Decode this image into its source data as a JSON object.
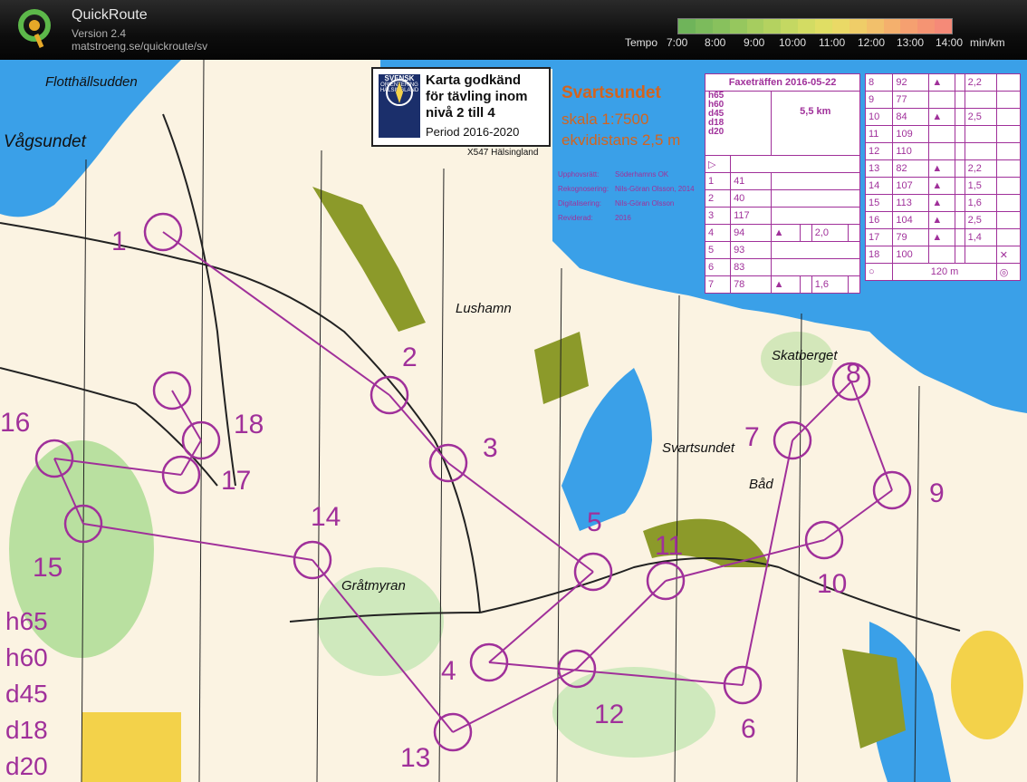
{
  "app": {
    "name": "QuickRoute",
    "version": "Version 2.4",
    "url": "matstroeng.se/quickroute/sv"
  },
  "tempo": {
    "label": "Tempo",
    "ticks": [
      "7:00",
      "8:00",
      "9:00",
      "10:00",
      "11:00",
      "12:00",
      "13:00",
      "14:00"
    ],
    "unit": "min/km"
  },
  "map": {
    "approval": {
      "line1": "Karta godkänd",
      "line2": "för tävling inom",
      "line3": "nivå 2 till 4",
      "period": "Period 2016-2020",
      "badge1": "SVENSK",
      "badge2": "ORIENTERING",
      "badge3": "HÄLSINGLAND",
      "code": "X547 Hälsingland"
    },
    "title": {
      "name": "Svartsundet",
      "scale": "skala 1:7500",
      "equidistance": "ekvidistans 2,5 m"
    },
    "credits": [
      {
        "label": "Upphovsrätt:",
        "value": "Söderhamns OK"
      },
      {
        "label": "Rekognosering:",
        "value": "Nils-Göran Olsson, 2014"
      },
      {
        "label": "Digitalisering:",
        "value": "Nils-Göran Olsson"
      },
      {
        "label": "Reviderad:",
        "value": "2016"
      }
    ],
    "places": [
      "Flotthällsudden",
      "Vågsundet",
      "Lushamn",
      "Skatberget",
      "Svartsundet",
      "Båd",
      "Gråtmyran"
    ],
    "controls": [
      "1",
      "2",
      "3",
      "4",
      "5",
      "6",
      "7",
      "8",
      "9",
      "10",
      "11",
      "12",
      "13",
      "14",
      "15",
      "16",
      "17",
      "18"
    ],
    "classes": [
      "h65",
      "h60",
      "d45",
      "d18",
      "d20"
    ],
    "descriptions": {
      "event": "Faxeträffen 2016-05-22",
      "classes": [
        "h65",
        "h60",
        "d45",
        "d18",
        "d20"
      ],
      "length": "5,5 km",
      "left": [
        {
          "n": "1",
          "code": "41"
        },
        {
          "n": "2",
          "code": "40"
        },
        {
          "n": "3",
          "code": "117"
        },
        {
          "n": "4",
          "code": "94",
          "dim": "2,0"
        },
        {
          "n": "5",
          "code": "93"
        },
        {
          "n": "6",
          "code": "83"
        },
        {
          "n": "7",
          "code": "78",
          "dim": "1,6"
        }
      ],
      "right": [
        {
          "n": "8",
          "code": "92",
          "dim": "2,2"
        },
        {
          "n": "9",
          "code": "77"
        },
        {
          "n": "10",
          "code": "84",
          "dim": "2,5"
        },
        {
          "n": "11",
          "code": "109"
        },
        {
          "n": "12",
          "code": "110"
        },
        {
          "n": "13",
          "code": "82",
          "dim": "2,2"
        },
        {
          "n": "14",
          "code": "107",
          "dim": "1,5"
        },
        {
          "n": "15",
          "code": "113",
          "dim": "1,6"
        },
        {
          "n": "16",
          "code": "104",
          "dim": "2,5"
        },
        {
          "n": "17",
          "code": "79",
          "dim": "1,4"
        },
        {
          "n": "18",
          "code": "100"
        }
      ],
      "finish": "120 m"
    }
  },
  "colors": {
    "water": "#3aa0e8",
    "forest": "#ffffff",
    "open": "#fbf3e2",
    "vegetation": "#8fce6e",
    "yellow": "#f3d24a",
    "course": "#a0309a",
    "title": "#d3641e"
  }
}
